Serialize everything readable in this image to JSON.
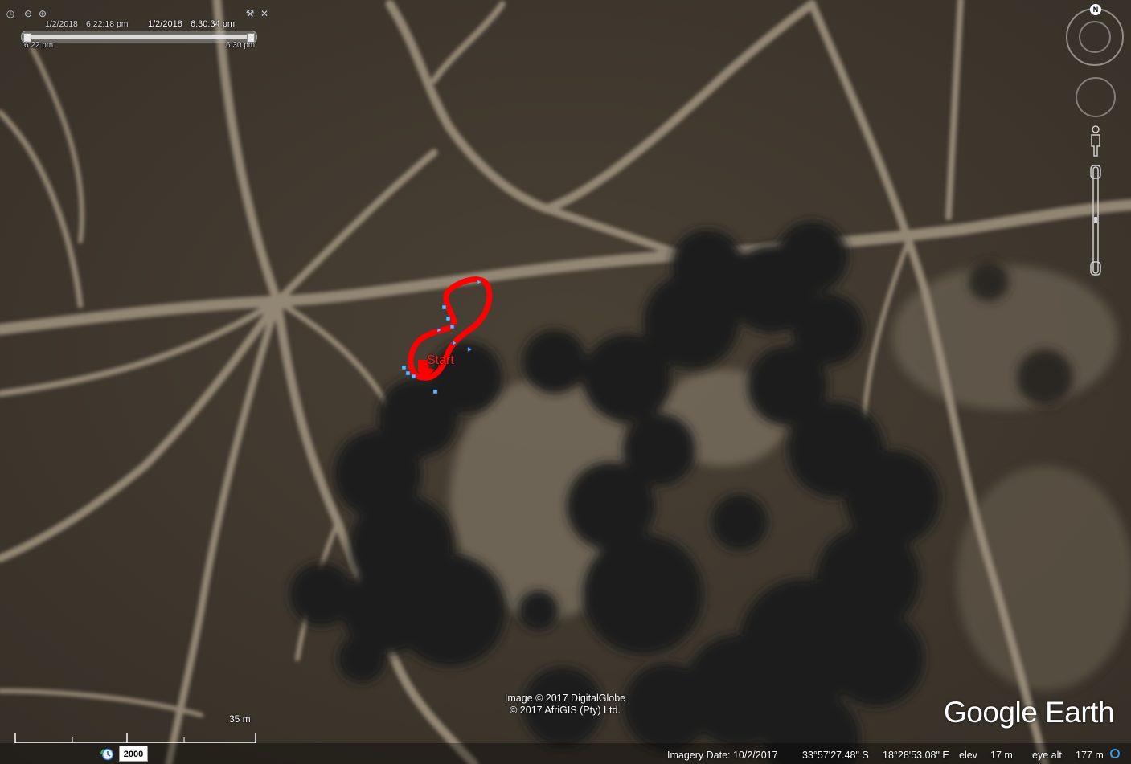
{
  "time_slider": {
    "start_date": "1/2/2018",
    "start_time": "6:22:18 pm",
    "end_date": "1/2/2018",
    "end_time": "6:30:34 pm",
    "min_label": "6:22 pm",
    "max_label": "6:30 pm"
  },
  "navigation": {
    "north_label": "N"
  },
  "track": {
    "start_label": "Start",
    "color": "#ff0000",
    "marker_color": "#6fb6ff"
  },
  "credits": {
    "line1": "Image © 2017 DigitalGlobe",
    "line2": "© 2017 AfriGIS (Pty) Ltd."
  },
  "logo": {
    "part1": "Google",
    "part2": "Earth"
  },
  "scale": {
    "label": "35 m"
  },
  "status": {
    "year": "2000",
    "imagery_date": "Imagery Date: 10/2/2017",
    "latitude": "33°57'27.48\" S",
    "longitude": "18°28'53.08\" E",
    "elev_label": "elev",
    "elev_value": "17 m",
    "eye_alt_label": "eye alt",
    "eye_alt_value": "177 m"
  },
  "icons": {
    "historical_imagery": "clock-icon",
    "zoom_in": "zoom-in-icon",
    "zoom_out": "zoom-out-icon",
    "settings": "wrench-icon",
    "close": "close-icon",
    "streaming": "streaming-icon"
  }
}
